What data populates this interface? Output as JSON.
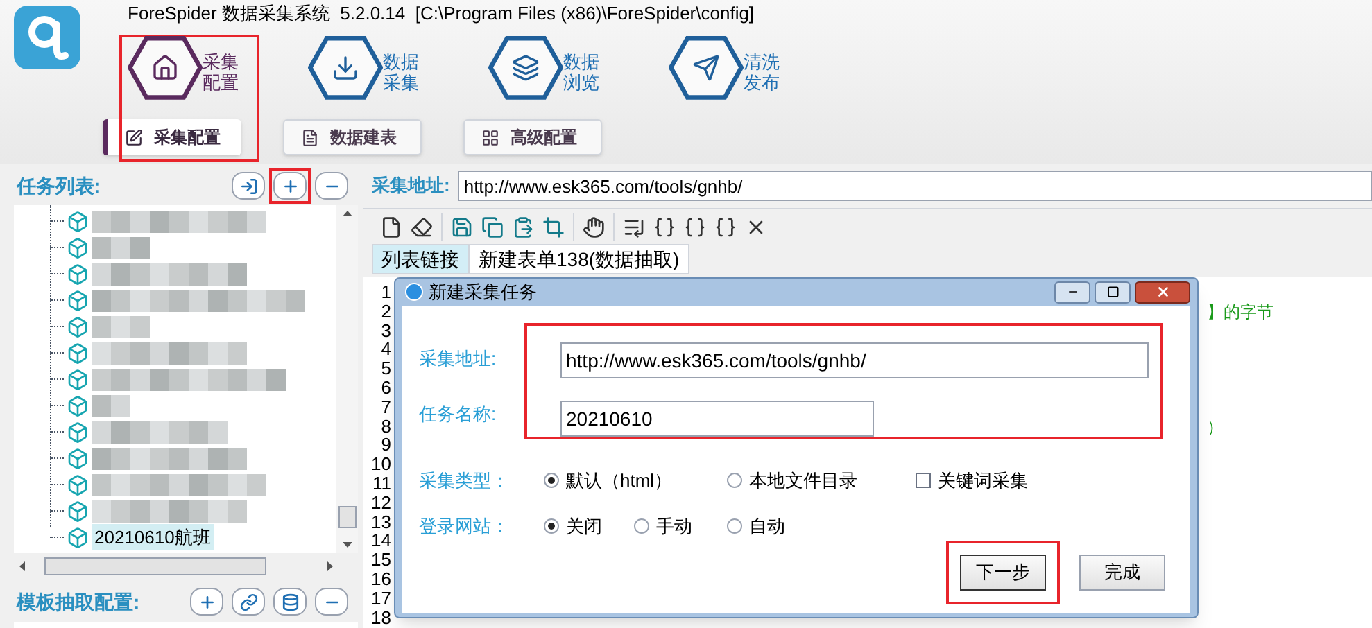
{
  "window": {
    "title": "ForeSpider 数据采集系统  5.2.0.14  [C:\\Program Files (x86)\\ForeSpider\\config]"
  },
  "nav": [
    {
      "kind": "home",
      "lines": [
        "采集",
        "配置"
      ],
      "selected": true,
      "highlighted": true
    },
    {
      "kind": "download",
      "lines": [
        "数据",
        "采集"
      ],
      "selected": false,
      "highlighted": false
    },
    {
      "kind": "layers",
      "lines": [
        "数据",
        "浏览"
      ],
      "selected": false,
      "highlighted": false
    },
    {
      "kind": "send",
      "lines": [
        "清洗",
        "发布"
      ],
      "selected": false,
      "highlighted": false
    }
  ],
  "subtabs": [
    {
      "kind": "edit",
      "label": "采集配置",
      "selected": true
    },
    {
      "kind": "file",
      "label": "数据建表",
      "selected": false
    },
    {
      "kind": "grid",
      "label": "高级配置",
      "selected": false
    }
  ],
  "task_panel": {
    "title": "任务列表:",
    "buttons": [
      {
        "kind": "import",
        "highlighted": false
      },
      {
        "kind": "add",
        "highlighted": true
      },
      {
        "kind": "remove",
        "highlighted": false
      }
    ],
    "tasks": [
      {
        "kind": "blurred"
      },
      {
        "kind": "blurred"
      },
      {
        "kind": "blurred"
      },
      {
        "kind": "blurred"
      },
      {
        "kind": "blurred"
      },
      {
        "kind": "blurred"
      },
      {
        "kind": "blurred"
      },
      {
        "kind": "blurred"
      },
      {
        "kind": "blurred"
      },
      {
        "kind": "blurred"
      },
      {
        "kind": "blurred"
      },
      {
        "kind": "blurred"
      },
      {
        "kind": "task",
        "label": "20210610航班",
        "selected": true
      }
    ]
  },
  "template_panel": {
    "title": "模板抽取配置:",
    "buttons": [
      {
        "kind": "add"
      },
      {
        "kind": "link"
      },
      {
        "kind": "database"
      },
      {
        "kind": "remove"
      }
    ]
  },
  "address": {
    "label": "采集地址:",
    "value": "http://www.esk365.com/tools/gnhb/"
  },
  "toolbar": [
    {
      "kind": "new"
    },
    {
      "kind": "erase"
    },
    {
      "kind": "sep"
    },
    {
      "kind": "save"
    },
    {
      "kind": "copy"
    },
    {
      "kind": "paste"
    },
    {
      "kind": "crop"
    },
    {
      "kind": "sep"
    },
    {
      "kind": "hand"
    },
    {
      "kind": "sep"
    },
    {
      "kind": "list"
    },
    {
      "kind": "brace"
    },
    {
      "kind": "brace"
    },
    {
      "kind": "brace"
    },
    {
      "kind": "close"
    }
  ],
  "editor_tabs": [
    {
      "label": "列表链接",
      "selected": true
    },
    {
      "label": "新建表单138(数据抽取)",
      "selected": false
    }
  ],
  "editor": {
    "lines": [
      {
        "number": "1"
      },
      {
        "number": "2",
        "text": "】的字节"
      },
      {
        "number": "3"
      },
      {
        "number": "4"
      },
      {
        "number": "5"
      },
      {
        "number": "6"
      },
      {
        "number": "7"
      },
      {
        "number": "8",
        "text": "）"
      },
      {
        "number": "9"
      },
      {
        "number": "10"
      },
      {
        "number": "11"
      },
      {
        "number": "12"
      },
      {
        "number": "13"
      },
      {
        "number": "14"
      },
      {
        "number": "15"
      },
      {
        "number": "16"
      },
      {
        "number": "17"
      },
      {
        "number": "18"
      }
    ]
  },
  "dialog": {
    "title": "新建采集任务",
    "fields_highlighted": true,
    "fields": [
      {
        "label": "采集地址:",
        "value": "http://www.esk365.com/tools/gnhb/",
        "wide": true
      },
      {
        "label": "任务名称:",
        "value": "20210610",
        "wide": false
      }
    ],
    "options": [
      {
        "label": "采集类型：",
        "choices": [
          {
            "kind": "radio",
            "label": "默认（html）",
            "selected": true
          },
          {
            "kind": "radio",
            "label": "本地文件目录",
            "selected": false
          },
          {
            "kind": "checkbox",
            "label": "关键词采集",
            "checked": false
          }
        ]
      },
      {
        "label": "登录网站：",
        "choices": [
          {
            "kind": "radio",
            "label": "关闭",
            "selected": true
          },
          {
            "kind": "radio",
            "label": "手动",
            "selected": false
          },
          {
            "kind": "radio",
            "label": "自动",
            "selected": false
          }
        ]
      }
    ],
    "buttons": [
      {
        "label": "下一步",
        "highlighted": true
      },
      {
        "label": "完成",
        "highlighted": false
      }
    ]
  }
}
